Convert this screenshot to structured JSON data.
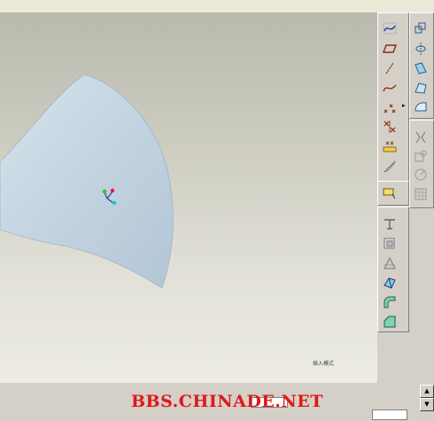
{
  "viewport": {
    "status_text": "插入模式",
    "background_top": "#b9b9ae",
    "background_bottom": "#edece4",
    "surface_color": "#c3d3e0"
  },
  "toolbar_left": {
    "tools": [
      "sketch-curve-icon",
      "plane-icon",
      "line-icon",
      "spline-icon",
      "point-icon",
      "pattern-icon",
      "dimension-icon",
      "offset-curve-icon"
    ],
    "flyout_arrow": "▸"
  },
  "toolbar_right": {
    "tools": [
      "extrude-icon",
      "revolve-icon",
      "sweep-icon",
      "blend-surface-icon",
      "boundary-surface-icon",
      "trim-icon",
      "split-icon",
      "face-icon",
      "grid-icon"
    ]
  },
  "toolbar_lower": {
    "tools": [
      "datum-tag-icon",
      "rib-icon",
      "draft-icon",
      "solid-icon",
      "round-icon",
      "chamfer-icon"
    ]
  },
  "footer": {
    "watermark": "BBS.CHINADE.NET",
    "scroll_up": "▲",
    "scroll_down": "▼",
    "watermark_color": "#e01818"
  }
}
